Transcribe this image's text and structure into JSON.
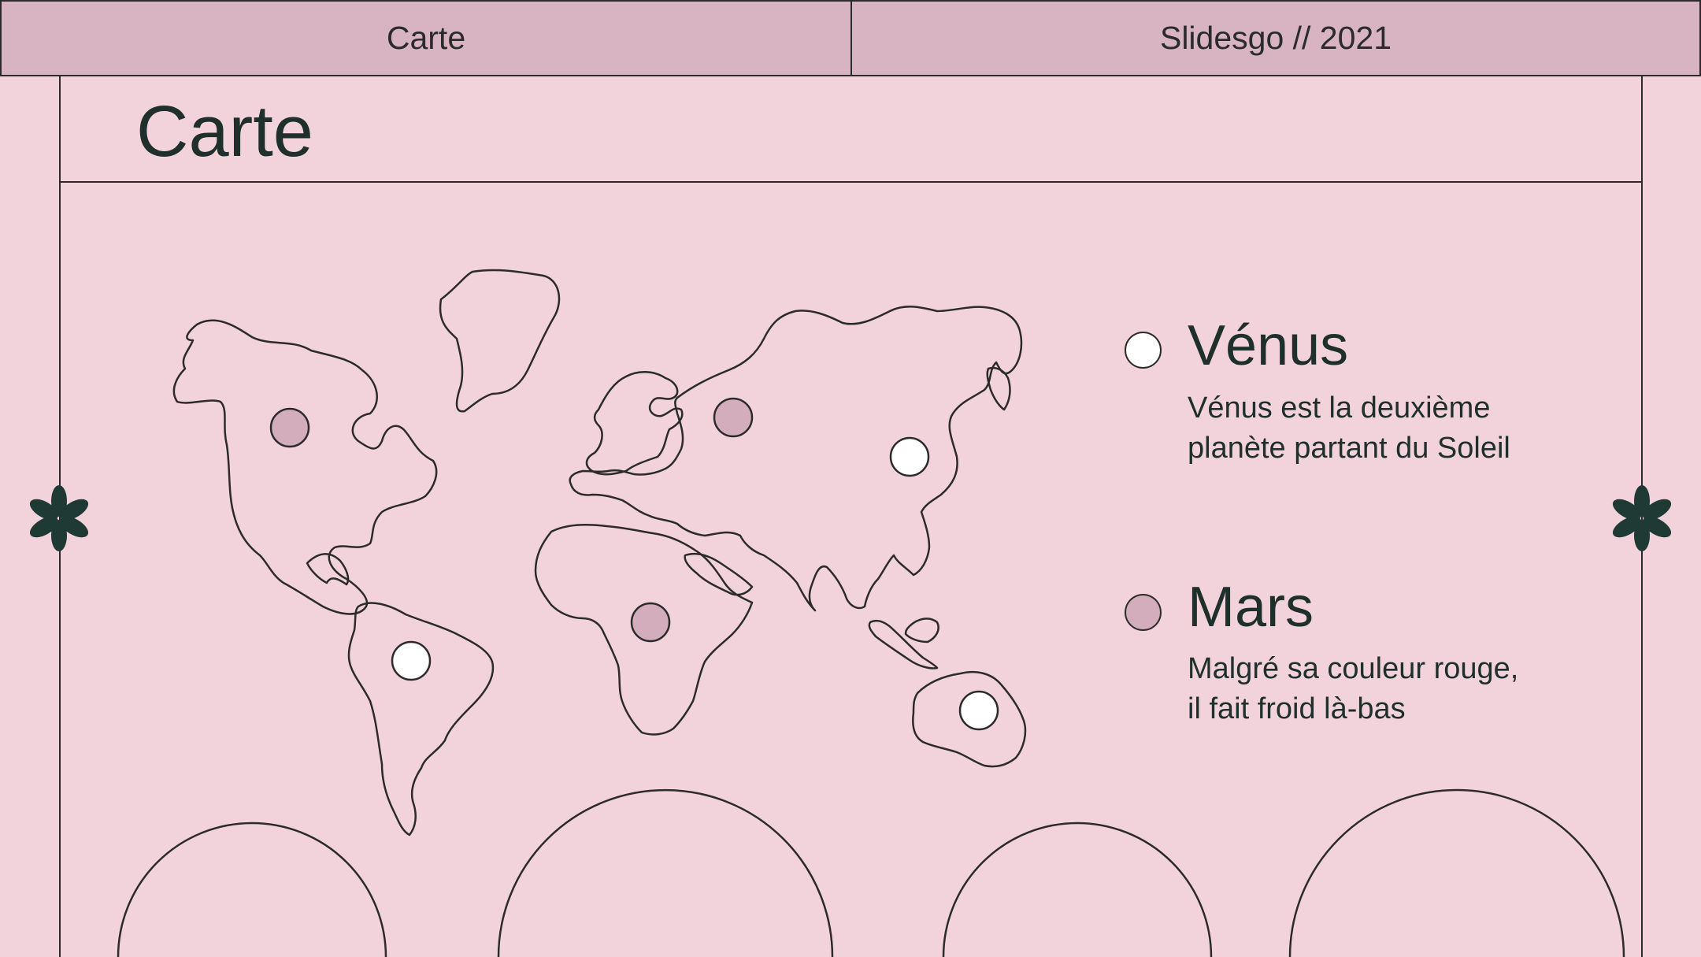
{
  "header": {
    "left_label": "Carte",
    "right_label": "Slidesgo // 2021"
  },
  "page_title": "Carte",
  "colors": {
    "background": "#f2d3db",
    "header_bg": "#d8b4c2",
    "line": "#2b2b2b",
    "text": "#1f2f2b",
    "marker_mauve": "#d4adbd",
    "marker_white": "#ffffff"
  },
  "legend": [
    {
      "title": "Vénus",
      "line1": "Vénus est la deuxième",
      "line2": "planète partant du Soleil",
      "marker": "white"
    },
    {
      "title": "Mars",
      "line1": "Malgré sa couleur rouge,",
      "line2": "il fait froid là-bas",
      "marker": "mauve"
    }
  ],
  "map": {
    "icon": "world-map-outline",
    "markers": [
      {
        "region": "north-america",
        "color": "mauve"
      },
      {
        "region": "south-america",
        "color": "white"
      },
      {
        "region": "europe",
        "color": "mauve"
      },
      {
        "region": "africa",
        "color": "mauve"
      },
      {
        "region": "asia",
        "color": "white"
      },
      {
        "region": "australia",
        "color": "white"
      }
    ]
  },
  "decorations": [
    "asterisk-icon",
    "asterisk-icon"
  ]
}
